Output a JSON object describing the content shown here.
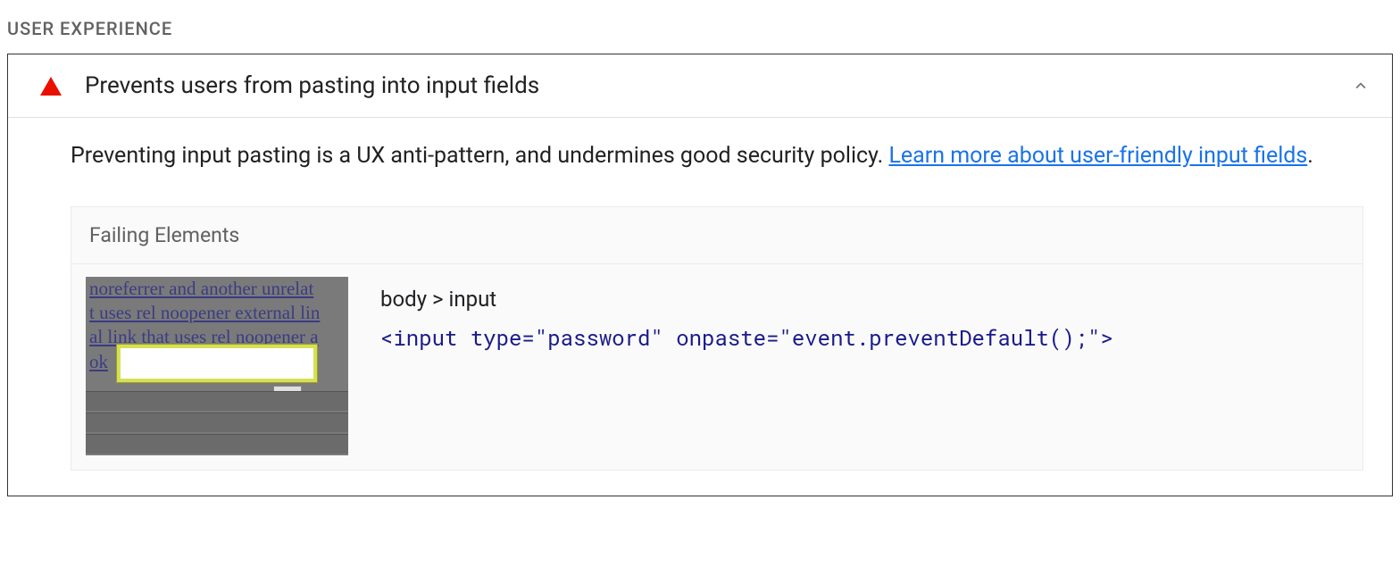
{
  "section": {
    "heading": "USER EXPERIENCE"
  },
  "audit": {
    "title": "Prevents users from pasting into input fields",
    "status": "fail",
    "description_prefix": "Preventing input pasting is a UX anti-pattern, and undermines good security policy. ",
    "learn_more_text": "Learn more about user-friendly input fields",
    "description_suffix": "."
  },
  "failing": {
    "header": "Failing Elements",
    "thumbnail_text": {
      "line1": "  noreferrer and another unrelat",
      "line2": "t uses rel noopener external lin",
      "line3": "al link that uses rel noopener a",
      "line4": "  ok"
    },
    "element": {
      "selector": "body > input",
      "snippet": "<input type=\"password\" onpaste=\"event.preventDefault();\">"
    }
  }
}
